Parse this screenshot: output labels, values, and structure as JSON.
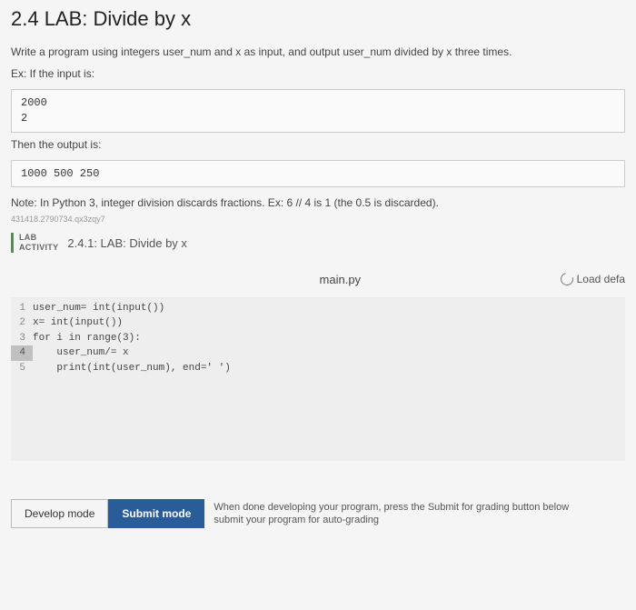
{
  "title": "2.4 LAB: Divide by x",
  "description": "Write a program using integers user_num and x as input, and output user_num divided by x three times.",
  "ex_label": "Ex: If the input is:",
  "input_example": "2000\n2",
  "then_label": "Then the output is:",
  "output_example": "1000 500 250",
  "note": "Note: In Python 3, integer division discards fractions. Ex: 6 // 4 is 1 (the 0.5 is discarded).",
  "activity_id": "431418.2790734.qx3zqy7",
  "lab_label_line1": "LAB",
  "lab_label_line2": "ACTIVITY",
  "lab_title": "2.4.1: LAB: Divide by x",
  "filename": "main.py",
  "load_default": "Load defa",
  "code": {
    "l1": "user_num= int(input())",
    "l2": "x= int(input())",
    "l3": "for i in range(3):",
    "l4": "    user_num/= x",
    "l5": "    print(int(user_num), end=' ')"
  },
  "gutter": {
    "n1": "1",
    "n2": "2",
    "n3": "3",
    "n4": "4",
    "n5": "5"
  },
  "develop_mode": "Develop mode",
  "submit_mode": "Submit mode",
  "bottom_text_l1": "When done developing your program, press the Submit for grading button below",
  "bottom_text_l2": "submit your program for auto-grading"
}
